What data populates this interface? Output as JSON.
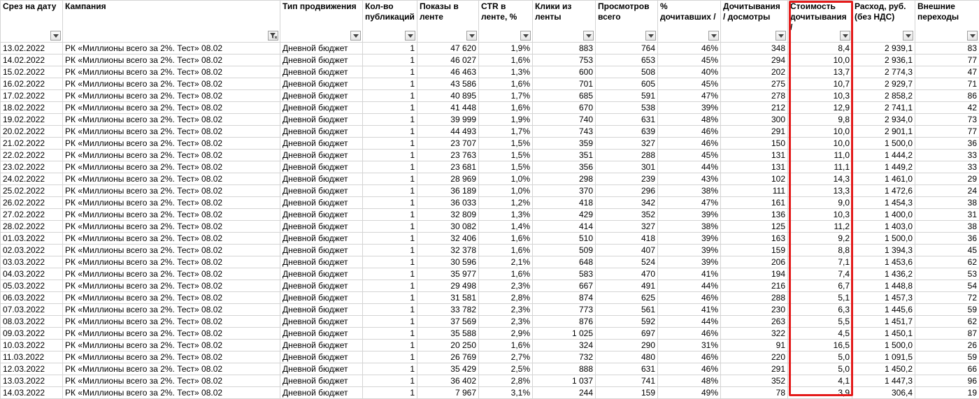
{
  "columns": [
    {
      "key": "date",
      "label": "Срез на дату"
    },
    {
      "key": "campaign",
      "label": "Кампания"
    },
    {
      "key": "type",
      "label": "Тип продвижения"
    },
    {
      "key": "pubs",
      "label": "Кол-во публикаций"
    },
    {
      "key": "shows",
      "label": "Показы в ленте"
    },
    {
      "key": "ctr",
      "label": "CTR в ленте, %"
    },
    {
      "key": "clicks",
      "label": "Клики из ленты"
    },
    {
      "key": "views",
      "label": "Просмотров всего"
    },
    {
      "key": "pct",
      "label": "% дочитавших /"
    },
    {
      "key": "reads",
      "label": "Дочитывания / досмотры"
    },
    {
      "key": "cost",
      "label": "Стоимость дочитывания /"
    },
    {
      "key": "spend",
      "label": "Расход, руб. (без НДС)"
    },
    {
      "key": "ext",
      "label": "Внешние переходы"
    }
  ],
  "colors": {
    "highlight": "#e41b1b",
    "grid": "#d4d4d4"
  },
  "icons": {
    "filter": "chevron-down-icon",
    "active_filter": "funnel-icon"
  },
  "rows": [
    [
      "13.02.2022",
      "РК «Миллионы всего за 2%. Тест» 08.02",
      "Дневной бюджет",
      "1",
      "47 620",
      "1,9%",
      "883",
      "764",
      "46%",
      "348",
      "8,4",
      "2 939,1",
      "83"
    ],
    [
      "14.02.2022",
      "РК «Миллионы всего за 2%. Тест» 08.02",
      "Дневной бюджет",
      "1",
      "46 027",
      "1,6%",
      "753",
      "653",
      "45%",
      "294",
      "10,0",
      "2 936,1",
      "77"
    ],
    [
      "15.02.2022",
      "РК «Миллионы всего за 2%. Тест» 08.02",
      "Дневной бюджет",
      "1",
      "46 463",
      "1,3%",
      "600",
      "508",
      "40%",
      "202",
      "13,7",
      "2 774,3",
      "47"
    ],
    [
      "16.02.2022",
      "РК «Миллионы всего за 2%. Тест» 08.02",
      "Дневной бюджет",
      "1",
      "43 586",
      "1,6%",
      "701",
      "605",
      "45%",
      "275",
      "10,7",
      "2 929,7",
      "71"
    ],
    [
      "17.02.2022",
      "РК «Миллионы всего за 2%. Тест» 08.02",
      "Дневной бюджет",
      "1",
      "40 895",
      "1,7%",
      "685",
      "591",
      "47%",
      "278",
      "10,3",
      "2 858,2",
      "86"
    ],
    [
      "18.02.2022",
      "РК «Миллионы всего за 2%. Тест» 08.02",
      "Дневной бюджет",
      "1",
      "41 448",
      "1,6%",
      "670",
      "538",
      "39%",
      "212",
      "12,9",
      "2 741,1",
      "42"
    ],
    [
      "19.02.2022",
      "РК «Миллионы всего за 2%. Тест» 08.02",
      "Дневной бюджет",
      "1",
      "39 999",
      "1,9%",
      "740",
      "631",
      "48%",
      "300",
      "9,8",
      "2 934,0",
      "73"
    ],
    [
      "20.02.2022",
      "РК «Миллионы всего за 2%. Тест» 08.02",
      "Дневной бюджет",
      "1",
      "44 493",
      "1,7%",
      "743",
      "639",
      "46%",
      "291",
      "10,0",
      "2 901,1",
      "77"
    ],
    [
      "21.02.2022",
      "РК «Миллионы всего за 2%. Тест» 08.02",
      "Дневной бюджет",
      "1",
      "23 707",
      "1,5%",
      "359",
      "327",
      "46%",
      "150",
      "10,0",
      "1 500,0",
      "36"
    ],
    [
      "22.02.2022",
      "РК «Миллионы всего за 2%. Тест» 08.02",
      "Дневной бюджет",
      "1",
      "23 763",
      "1,5%",
      "351",
      "288",
      "45%",
      "131",
      "11,0",
      "1 444,2",
      "33"
    ],
    [
      "23.02.2022",
      "РК «Миллионы всего за 2%. Тест» 08.02",
      "Дневной бюджет",
      "1",
      "23 681",
      "1,5%",
      "356",
      "301",
      "44%",
      "131",
      "11,1",
      "1 449,2",
      "33"
    ],
    [
      "24.02.2022",
      "РК «Миллионы всего за 2%. Тест» 08.02",
      "Дневной бюджет",
      "1",
      "28 969",
      "1,0%",
      "298",
      "239",
      "43%",
      "102",
      "14,3",
      "1 461,0",
      "29"
    ],
    [
      "25.02.2022",
      "РК «Миллионы всего за 2%. Тест» 08.02",
      "Дневной бюджет",
      "1",
      "36 189",
      "1,0%",
      "370",
      "296",
      "38%",
      "111",
      "13,3",
      "1 472,6",
      "24"
    ],
    [
      "26.02.2022",
      "РК «Миллионы всего за 2%. Тест» 08.02",
      "Дневной бюджет",
      "1",
      "36 033",
      "1,2%",
      "418",
      "342",
      "47%",
      "161",
      "9,0",
      "1 454,3",
      "38"
    ],
    [
      "27.02.2022",
      "РК «Миллионы всего за 2%. Тест» 08.02",
      "Дневной бюджет",
      "1",
      "32 809",
      "1,3%",
      "429",
      "352",
      "39%",
      "136",
      "10,3",
      "1 400,0",
      "31"
    ],
    [
      "28.02.2022",
      "РК «Миллионы всего за 2%. Тест» 08.02",
      "Дневной бюджет",
      "1",
      "30 082",
      "1,4%",
      "414",
      "327",
      "38%",
      "125",
      "11,2",
      "1 403,0",
      "38"
    ],
    [
      "01.03.2022",
      "РК «Миллионы всего за 2%. Тест» 08.02",
      "Дневной бюджет",
      "1",
      "32 406",
      "1,6%",
      "510",
      "418",
      "39%",
      "163",
      "9,2",
      "1 500,0",
      "36"
    ],
    [
      "02.03.2022",
      "РК «Миллионы всего за 2%. Тест» 08.02",
      "Дневной бюджет",
      "1",
      "32 378",
      "1,6%",
      "509",
      "407",
      "39%",
      "159",
      "8,8",
      "1 394,3",
      "45"
    ],
    [
      "03.03.2022",
      "РК «Миллионы всего за 2%. Тест» 08.02",
      "Дневной бюджет",
      "1",
      "30 596",
      "2,1%",
      "648",
      "524",
      "39%",
      "206",
      "7,1",
      "1 453,6",
      "62"
    ],
    [
      "04.03.2022",
      "РК «Миллионы всего за 2%. Тест» 08.02",
      "Дневной бюджет",
      "1",
      "35 977",
      "1,6%",
      "583",
      "470",
      "41%",
      "194",
      "7,4",
      "1 436,2",
      "53"
    ],
    [
      "05.03.2022",
      "РК «Миллионы всего за 2%. Тест» 08.02",
      "Дневной бюджет",
      "1",
      "29 498",
      "2,3%",
      "667",
      "491",
      "44%",
      "216",
      "6,7",
      "1 448,8",
      "54"
    ],
    [
      "06.03.2022",
      "РК «Миллионы всего за 2%. Тест» 08.02",
      "Дневной бюджет",
      "1",
      "31 581",
      "2,8%",
      "874",
      "625",
      "46%",
      "288",
      "5,1",
      "1 457,3",
      "72"
    ],
    [
      "07.03.2022",
      "РК «Миллионы всего за 2%. Тест» 08.02",
      "Дневной бюджет",
      "1",
      "33 782",
      "2,3%",
      "773",
      "561",
      "41%",
      "230",
      "6,3",
      "1 445,6",
      "59"
    ],
    [
      "08.03.2022",
      "РК «Миллионы всего за 2%. Тест» 08.02",
      "Дневной бюджет",
      "1",
      "37 569",
      "2,3%",
      "876",
      "592",
      "44%",
      "263",
      "5,5",
      "1 451,7",
      "62"
    ],
    [
      "09.03.2022",
      "РК «Миллионы всего за 2%. Тест» 08.02",
      "Дневной бюджет",
      "1",
      "35 588",
      "2,9%",
      "1 025",
      "697",
      "46%",
      "322",
      "4,5",
      "1 450,1",
      "87"
    ],
    [
      "10.03.2022",
      "РК «Миллионы всего за 2%. Тест» 08.02",
      "Дневной бюджет",
      "1",
      "20 250",
      "1,6%",
      "324",
      "290",
      "31%",
      "91",
      "16,5",
      "1 500,0",
      "26"
    ],
    [
      "11.03.2022",
      "РК «Миллионы всего за 2%. Тест» 08.02",
      "Дневной бюджет",
      "1",
      "26 769",
      "2,7%",
      "732",
      "480",
      "46%",
      "220",
      "5,0",
      "1 091,5",
      "59"
    ],
    [
      "12.03.2022",
      "РК «Миллионы всего за 2%. Тест» 08.02",
      "Дневной бюджет",
      "1",
      "35 429",
      "2,5%",
      "888",
      "631",
      "46%",
      "291",
      "5,0",
      "1 450,2",
      "66"
    ],
    [
      "13.03.2022",
      "РК «Миллионы всего за 2%. Тест» 08.02",
      "Дневной бюджет",
      "1",
      "36 402",
      "2,8%",
      "1 037",
      "741",
      "48%",
      "352",
      "4,1",
      "1 447,3",
      "96"
    ],
    [
      "14.03.2022",
      "РК «Миллионы всего за 2%. Тест» 08.02",
      "Дневной бюджет",
      "1",
      "7 967",
      "3,1%",
      "244",
      "159",
      "49%",
      "78",
      "3,9",
      "306,4",
      "19"
    ]
  ]
}
